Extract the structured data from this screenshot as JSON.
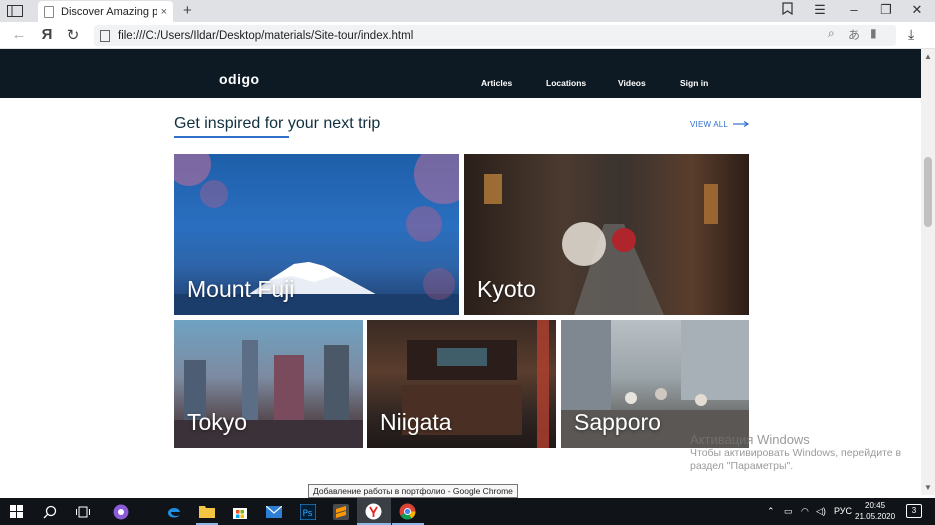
{
  "browser": {
    "tab_title": "Discover Amazing places",
    "tab_close": "×",
    "new_tab": "+",
    "url": "file:///C:/Users/Ildar/Desktop/materials/Site-tour/index.html",
    "yandex_glyph": "Я"
  },
  "site": {
    "logo": "odigo",
    "nav": [
      "Articles",
      "Locations",
      "Videos",
      "Sign in"
    ],
    "section_title": "Get inspired for your next trip",
    "view_all": "VIEW ALL",
    "accent_color": "#3171c9",
    "header_color": "#0e1a23",
    "cards": [
      {
        "label": "Mount Fuji"
      },
      {
        "label": "Kyoto"
      },
      {
        "label": "Tokyo"
      },
      {
        "label": "Niigata"
      },
      {
        "label": "Sapporo"
      }
    ]
  },
  "windows_activation": {
    "title": "Активация Windows",
    "line1": "Чтобы активировать Windows, перейдите в",
    "line2": "раздел \"Параметры\"."
  },
  "tooltip": "Добавление работы в портфолио - Google Chrome",
  "taskbar": {
    "language": "РУС",
    "time": "20:45",
    "date": "21.05.2020",
    "notification_count": "3"
  }
}
